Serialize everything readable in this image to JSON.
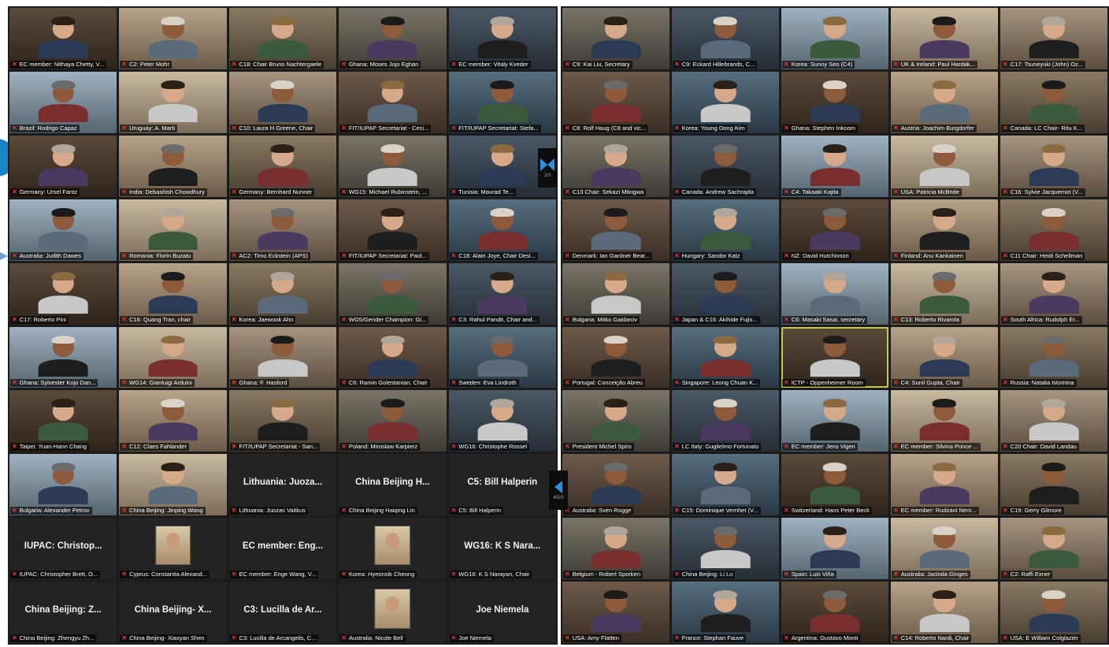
{
  "accent_color": "#c9c94a",
  "mic_icon_color": "#e53935",
  "left_panel": {
    "page_indicator": "2/3",
    "page_indicator_2": "4/5/3",
    "tiles": [
      {
        "label": "EC member: Nithaya Chetty, V...",
        "video": true
      },
      {
        "label": "C2: Peter Mohr",
        "video": true
      },
      {
        "label": "C18: Chair Bruno Nachtergaele",
        "video": true
      },
      {
        "label": "Ghana: Moses Jojo Eghan",
        "video": true
      },
      {
        "label": "EC member: Vitaly Kveder",
        "video": true
      },
      {
        "label": "Brazil: Rodrigo Capaz",
        "video": true
      },
      {
        "label": "Uruguay: A. Marti",
        "video": true
      },
      {
        "label": "C10: Laura H Greene, Chair",
        "video": true
      },
      {
        "label": "FIT/IUPAP Secretariat - Ceci...",
        "video": true
      },
      {
        "label": "FIT/IUPAP Secretariat: Stefa...",
        "video": true
      },
      {
        "label": "Germany: Ursel Fantz",
        "video": true
      },
      {
        "label": "India: Debashish Chowdhury",
        "video": true
      },
      {
        "label": "Germany: Bernhard Nunner",
        "video": true
      },
      {
        "label": "WG15: Michael Rubinstein, ...",
        "video": true
      },
      {
        "label": "Tunisia: Mourad Te...",
        "video": true
      },
      {
        "label": "Australia: Judith Dawes",
        "video": true
      },
      {
        "label": "Romania: Florin Buzatu",
        "video": true
      },
      {
        "label": "AC2: Timo Eckstein (APS)",
        "video": true
      },
      {
        "label": "FIT/IUPAP Secretariat: Paol...",
        "video": true
      },
      {
        "label": "C18: Alain Joye, Chair Desi...",
        "video": true
      },
      {
        "label": "C17: Roberto Pini",
        "video": true
      },
      {
        "label": "C16: Quang Tran, chair",
        "video": true
      },
      {
        "label": "Korea: Jaewook Ahn",
        "video": true
      },
      {
        "label": "WG5/Gender Champion: Gi...",
        "video": true
      },
      {
        "label": "C3: Rahul Pandit, Chair and...",
        "video": true
      },
      {
        "label": "Ghana: Sylvester Kojo Dan...",
        "video": true
      },
      {
        "label": "WG14: Gianluigi Arduini",
        "video": true
      },
      {
        "label": "Ghana: F. Hasford",
        "video": true
      },
      {
        "label": "C6: Ramin Golestanian, Chair",
        "video": true
      },
      {
        "label": "Sweden: Eva Lindroth",
        "video": true
      },
      {
        "label": "Taipei: Yuan-Hann Chang",
        "video": true
      },
      {
        "label": "C12: Claes Fahlander",
        "video": true
      },
      {
        "label": "FIT/IUPAP Secretariat - San...",
        "video": true
      },
      {
        "label": "Poland: Miroslaw Karpierz",
        "video": true
      },
      {
        "label": "WG16: Christophe Rossel",
        "video": true
      },
      {
        "label": "Bulgaria: Alexander Petrov",
        "video": true
      },
      {
        "label": "China Beijing: Jinping Wang",
        "video": true
      },
      {
        "label": "Lithuania: Juozas Vaitkus",
        "video": false,
        "big": "Lithuania: Juoza..."
      },
      {
        "label": "China Beijing Haiqing Lin",
        "video": false,
        "big": "China Beijing H..."
      },
      {
        "label": "C5: Bill Halperin",
        "video": false,
        "big": "C5: Bill Halperin"
      },
      {
        "label": "IUPAC: Christopher Brett, O...",
        "video": false,
        "big": "IUPAC: Christop..."
      },
      {
        "label": "Cyprus: Constantia Alexand...",
        "video": false,
        "big": "",
        "avatar": true
      },
      {
        "label": "EC member: Enge Wang, V...",
        "video": false,
        "big": "EC member: Eng..."
      },
      {
        "label": "Korea: Hyeonsik Cheong",
        "video": false,
        "big": "",
        "avatar": true
      },
      {
        "label": "WG16: K S Narayan, Chair",
        "video": false,
        "big": "WG16: K S Nara..."
      },
      {
        "label": "China Beijing: Zhengyu Zh...",
        "video": false,
        "big": "China Beijing: Z..."
      },
      {
        "label": "China Beijing- Xiaoyan Shen",
        "video": false,
        "big": "China Beijing- X..."
      },
      {
        "label": "C3: Lucilla de Arcangelis, C...",
        "video": false,
        "big": "C3: Lucilla de Ar..."
      },
      {
        "label": "Australia: Nicole Bell",
        "video": false,
        "big": "",
        "avatar": true
      },
      {
        "label": "Joe Niemela",
        "video": false,
        "big": "Joe Niemela"
      }
    ]
  },
  "right_panel": {
    "tiles": [
      {
        "label": "C9: Kai Liu, Secretary",
        "video": true
      },
      {
        "label": "C9: Eckard Hillebrands, C...",
        "video": true
      },
      {
        "label": "Korea: Sunny Seo (C4)",
        "video": true
      },
      {
        "label": "UK & Ireland: Paul Hardak...",
        "video": true
      },
      {
        "label": "C17: Tsuneyuki (John) Oz...",
        "video": true
      },
      {
        "label": "C8: Rolf Haug (C8 and vic...",
        "video": true
      },
      {
        "label": "Korea: Young Dong Kim",
        "video": true
      },
      {
        "label": "Ghana: Stephen Inkoom",
        "video": true
      },
      {
        "label": "Austria: Joachim Burgdorfer",
        "video": true
      },
      {
        "label": "Canada: LC Chair- Ritu K...",
        "video": true
      },
      {
        "label": "C13 Chair: Sekazi Mtingwa",
        "video": true
      },
      {
        "label": "Canada: Andrew Sachrajda",
        "video": true
      },
      {
        "label": "C4: Takaaki Kajita",
        "video": true
      },
      {
        "label": "USA: Patricia McBride",
        "video": true
      },
      {
        "label": "C16: Sylvie Jacquemot (V...",
        "video": true
      },
      {
        "label": "Denmark: Ian Gardner Bear...",
        "video": true
      },
      {
        "label": "Hungary: Sandor Katz",
        "video": true
      },
      {
        "label": "NZ: David Hutchinson",
        "video": true
      },
      {
        "label": "Finland: Anu Kankainen",
        "video": true
      },
      {
        "label": "C11 Chair: Heidi Schellman",
        "video": true
      },
      {
        "label": "Bulgaria: Mitko Gaidarov",
        "video": true
      },
      {
        "label": "Japan & C16: Akihide Fujis...",
        "video": true
      },
      {
        "label": "C6: Masaki Sasai, secretary",
        "video": true
      },
      {
        "label": "C13: Roberto Rivarola",
        "video": true
      },
      {
        "label": "South Africa: Rudolph Er...",
        "video": true
      },
      {
        "label": "Portugal: Conceição Abreu",
        "video": true
      },
      {
        "label": "Singapore: Leong Chuan K...",
        "video": true
      },
      {
        "label": "ICTP - Oppenheimer Room",
        "video": true,
        "active": true
      },
      {
        "label": "C4: Sunil Gupta, Chair",
        "video": true
      },
      {
        "label": "Russia: Natalia Istomina",
        "video": true
      },
      {
        "label": "President Michel Spiro",
        "video": true
      },
      {
        "label": "LC Italy: Guglielmo Fortunato",
        "video": true
      },
      {
        "label": "EC member: Jens Vigen",
        "video": true
      },
      {
        "label": "EC member: Silvina Ponce ...",
        "video": true
      },
      {
        "label": "C20 Chair: David Landau",
        "video": true
      },
      {
        "label": "Australia: Sven Rogge",
        "video": true
      },
      {
        "label": "C15: Dominique Vernhet (V...",
        "video": true
      },
      {
        "label": "Switzerland: Hans Peter Beck",
        "video": true
      },
      {
        "label": "EC member: Rudzani Nem...",
        "video": true
      },
      {
        "label": "C19: Gerry Gilmore",
        "video": true
      },
      {
        "label": "Belgium - Robert Sporken",
        "video": true
      },
      {
        "label": "China Beijing: Li Lu",
        "video": true
      },
      {
        "label": "Spain: Luis Viña",
        "video": true
      },
      {
        "label": "Australia: Jacinda Ginges",
        "video": true
      },
      {
        "label": "C2: Raffi Exner",
        "video": true
      },
      {
        "label": "USA: Amy Flatten",
        "video": true
      },
      {
        "label": "France: Stephan Fauve",
        "video": true
      },
      {
        "label": "Argentina: Gustavo Monti",
        "video": true
      },
      {
        "label": "C14: Roberto Nardi, Chair",
        "video": true
      },
      {
        "label": "USA: E William Colglazier",
        "video": true
      }
    ]
  }
}
